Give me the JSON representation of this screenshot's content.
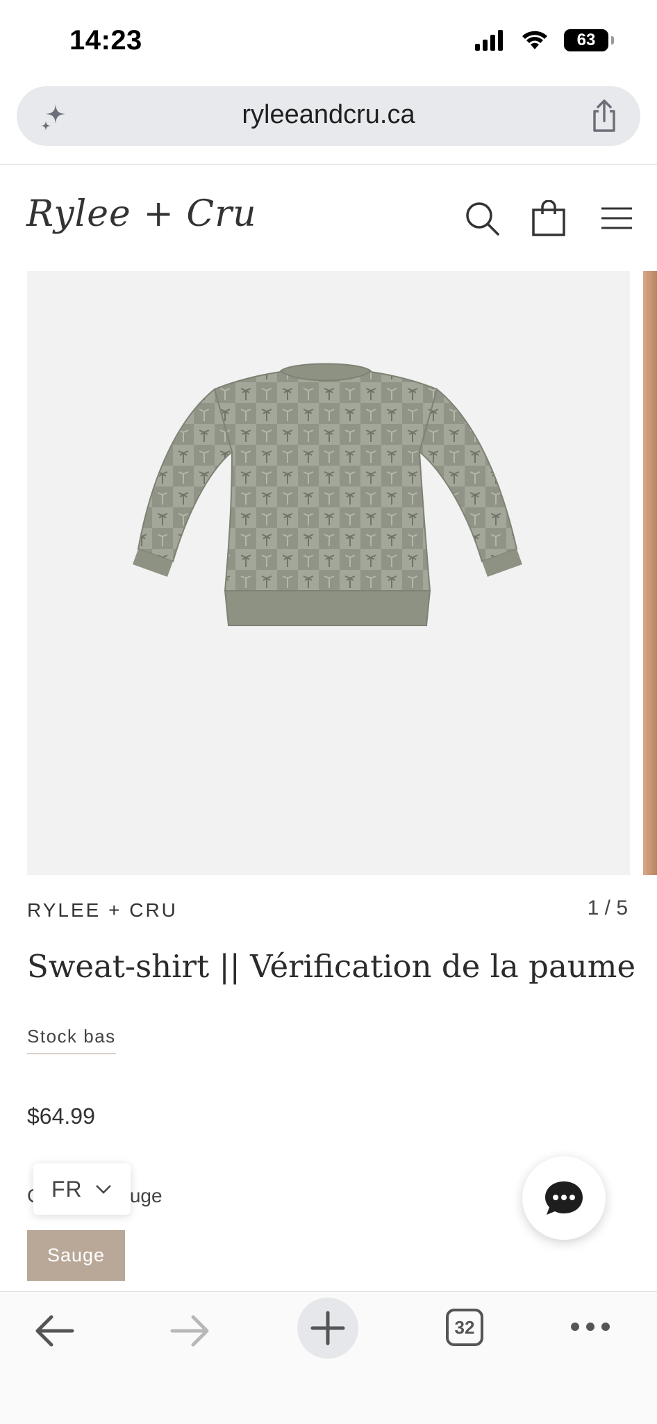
{
  "status": {
    "time": "14:23",
    "battery": "63"
  },
  "browser": {
    "url": "ryleeandcru.ca",
    "tab_count": "32"
  },
  "site": {
    "logo": "Rylee + Cru"
  },
  "product": {
    "brand": "RYLEE + CRU",
    "image_counter": "1 / 5",
    "title": "Sweat-shirt || Vérification de la paume",
    "stock": "Stock bas",
    "price": "$64.99",
    "color_label": "Couleur: Sauge",
    "color_option": "Sauge"
  },
  "language": {
    "current": "FR"
  },
  "colors": {
    "swatch": "#b9a898",
    "background": "#f2f2f2",
    "sweater": "#8d9283"
  },
  "icons": [
    "sparkle-icon",
    "share-icon",
    "search-icon",
    "bag-icon",
    "menu-icon",
    "chevron-down-icon",
    "chat-icon",
    "back-arrow-icon",
    "forward-arrow-icon",
    "plus-icon",
    "more-icon",
    "signal-icon",
    "wifi-icon"
  ]
}
